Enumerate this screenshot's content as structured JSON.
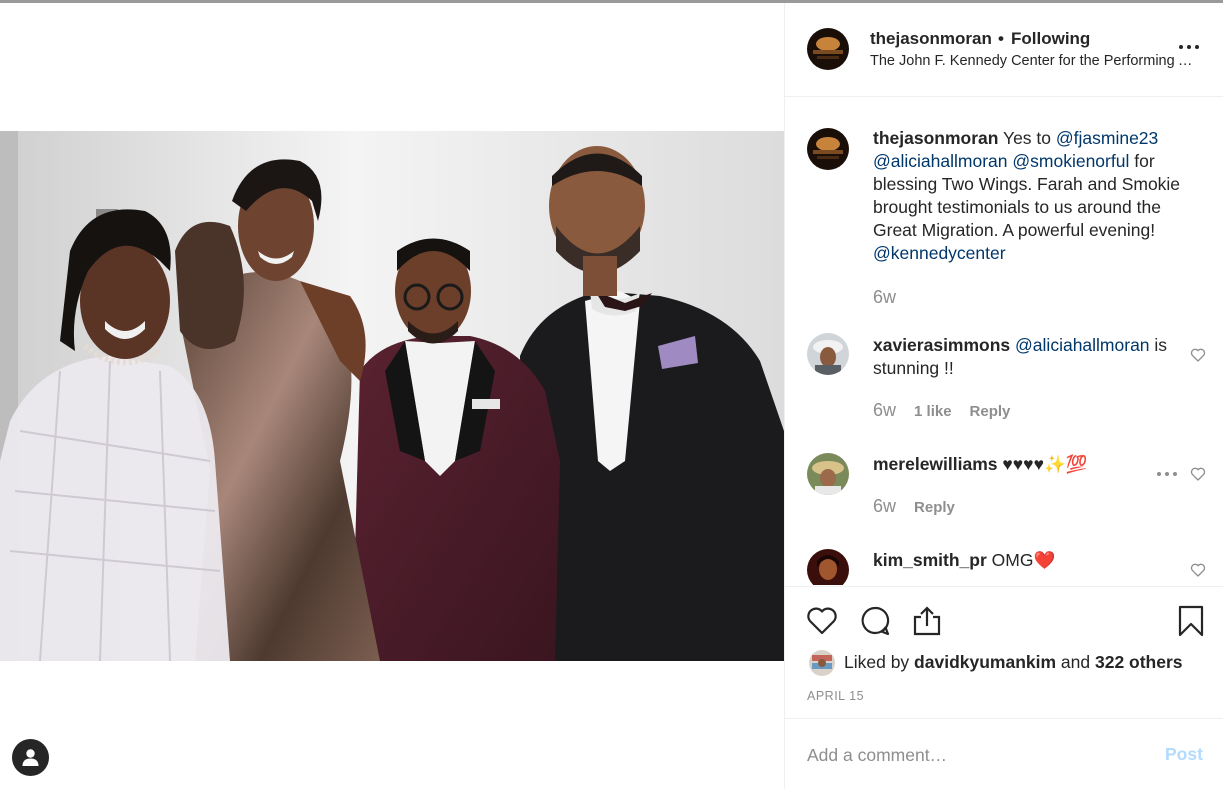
{
  "post": {
    "photo_alt": "Four people posing backstage",
    "header": {
      "username": "thejasonmoran",
      "separator": "•",
      "follow_state": "Following",
      "location": "The John F. Kennedy Center for the Performing Arts"
    },
    "caption": {
      "username": "thejasonmoran",
      "parts": {
        "p1": " Yes to ",
        "m1": "@fjasmine23",
        "m2": "@aliciahallmoran",
        "m3": "@smokienorful",
        "p2": " for blessing Two Wings. Farah and Smokie brought testimonials to us around the Great Migration. A powerful evening! ",
        "m4": "@kennedycenter"
      },
      "time": "6w"
    },
    "comments": [
      {
        "username": "xavierasimmons",
        "mention": "@aliciahallmoran",
        "text": " is stunning !!",
        "time": "6w",
        "likes": "1 like",
        "reply": "Reply"
      },
      {
        "username": "merelewilliams",
        "text": " ♥♥♥♥✨💯",
        "time": "6w",
        "reply": "Reply"
      },
      {
        "username": "kim_smith_pr",
        "text": " OMG❤️"
      }
    ],
    "likes": {
      "prefix": "Liked by ",
      "first_liker": "davidkyumankim",
      "joiner": " and ",
      "others": "322 others"
    },
    "date": "APRIL 15",
    "add_comment": {
      "placeholder": "Add a comment…",
      "post_label": "Post"
    }
  },
  "icons": {
    "like": "heart-icon",
    "comment": "comment-icon",
    "share": "share-icon",
    "save": "bookmark-icon",
    "more": "more-icon",
    "user_tag": "user-icon"
  },
  "colors": {
    "text": "#262626",
    "secondary": "#8e8e8e",
    "mention": "#00376b",
    "post_disabled": "#b3dbff",
    "border": "#efefef"
  }
}
